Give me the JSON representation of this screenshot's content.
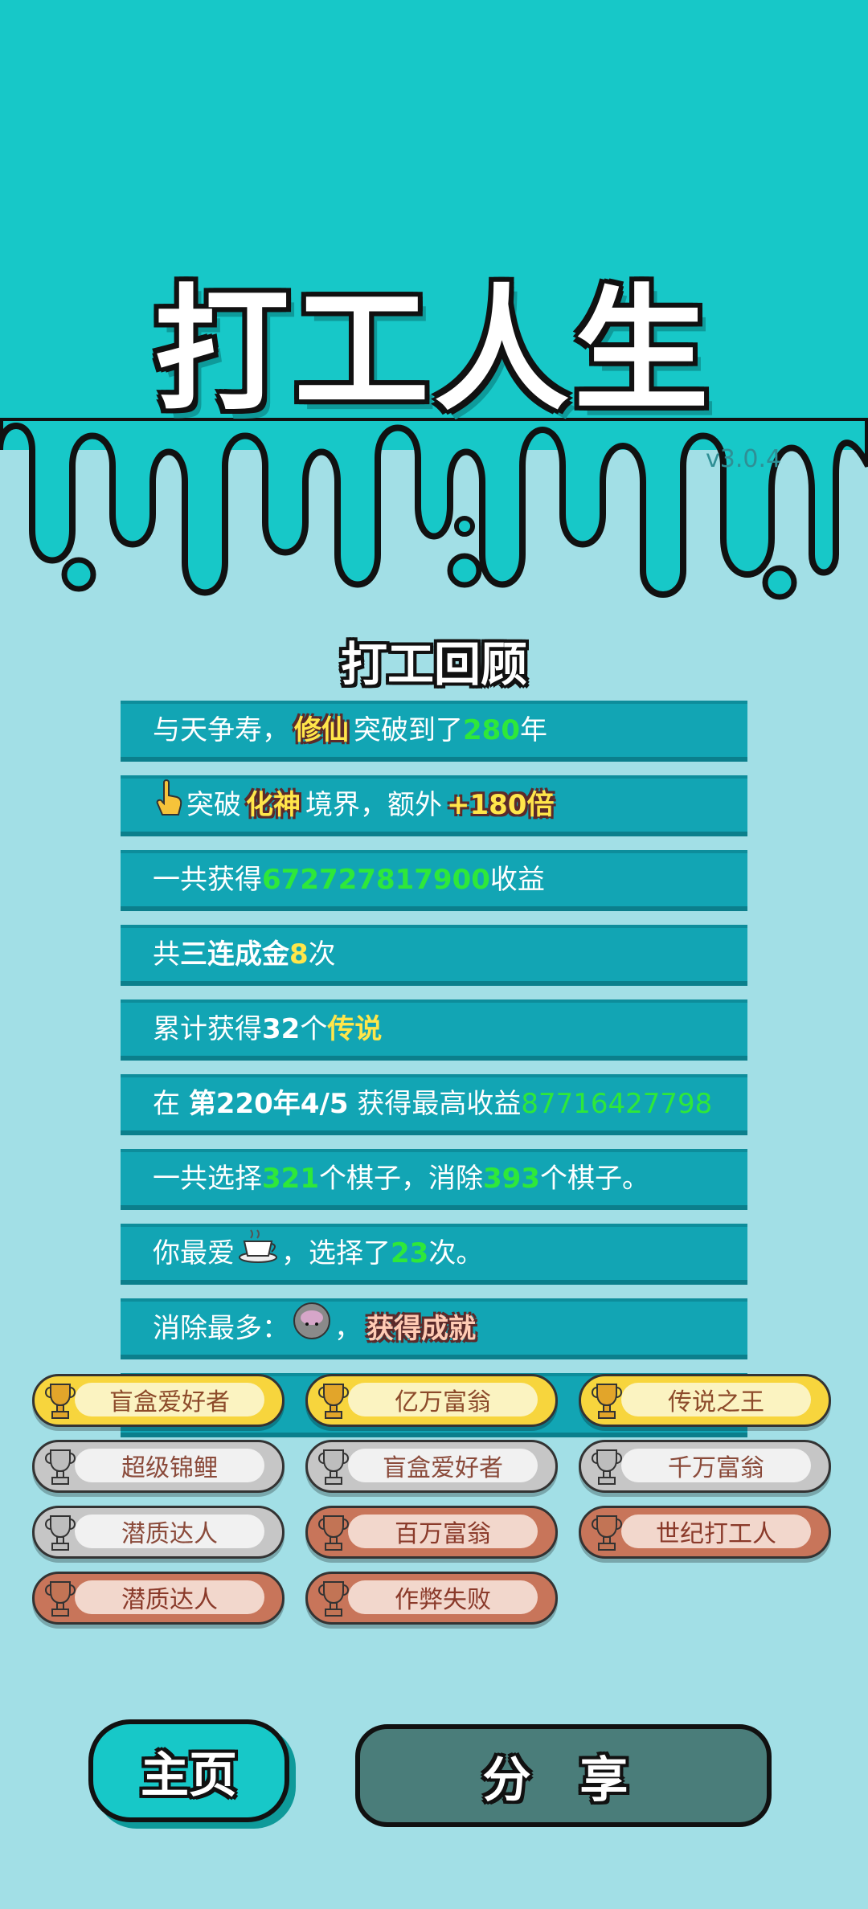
{
  "app": {
    "title": "打工人生",
    "version": "v3.0.4"
  },
  "review": {
    "title": "打工回顾",
    "rows": [
      {
        "p1": "与天争寿，",
        "hl": "修仙",
        "p2": "突破到了",
        "num": "280",
        "p3": "年"
      },
      {
        "p1": "突破",
        "hl": "化神",
        "p2": "境界，额外",
        "hl2": "+180倍"
      },
      {
        "p1": "一共获得",
        "num": "672727817900",
        "p2": "收益"
      },
      {
        "p1": "共",
        "bold": "三连成金",
        "num": "8",
        "p2": "次"
      },
      {
        "p1": "累计获得",
        "num": "32",
        "p2": "个",
        "hl": "传说"
      },
      {
        "p1": "在 ",
        "bold": "第220年4/5",
        "p2": " 获得最高收益",
        "num": "87716427798"
      },
      {
        "p1": "一共选择",
        "num": "321",
        "p2": "个棋子，消除",
        "num2": "393",
        "p3": "个棋子。"
      },
      {
        "p1": "你最爱",
        "p2": "，选择了",
        "num": "23",
        "p3": "次。"
      },
      {
        "p1": "消除最多：",
        "p2": "，",
        "hl": "获得成就"
      }
    ]
  },
  "achievements": [
    {
      "label": "盲盒爱好者",
      "tier": "gold"
    },
    {
      "label": "亿万富翁",
      "tier": "gold"
    },
    {
      "label": "传说之王",
      "tier": "gold"
    },
    {
      "label": "超级锦鲤",
      "tier": "silver"
    },
    {
      "label": "盲盒爱好者",
      "tier": "silver"
    },
    {
      "label": "千万富翁",
      "tier": "silver"
    },
    {
      "label": "潜质达人",
      "tier": "silver"
    },
    {
      "label": "百万富翁",
      "tier": "bronze"
    },
    {
      "label": "世纪打工人",
      "tier": "bronze"
    },
    {
      "label": "潜质达人",
      "tier": "bronze"
    },
    {
      "label": "作弊失败",
      "tier": "bronze"
    }
  ],
  "buttons": {
    "home": "主页",
    "share": "分 享"
  },
  "colors": {
    "top_teal": "#17c8c8",
    "background": "#a2dfe6",
    "row_bg": "#12a5b4",
    "highlight_green": "#2ee83a",
    "highlight_yellow": "#ffe64a",
    "share_button": "#4a7d7a"
  },
  "icons": {
    "row2": "pointing-hand-icon",
    "row8": "coffee-cup-icon",
    "row9": "chess-piece-icon",
    "achievement": "trophy-icon"
  }
}
